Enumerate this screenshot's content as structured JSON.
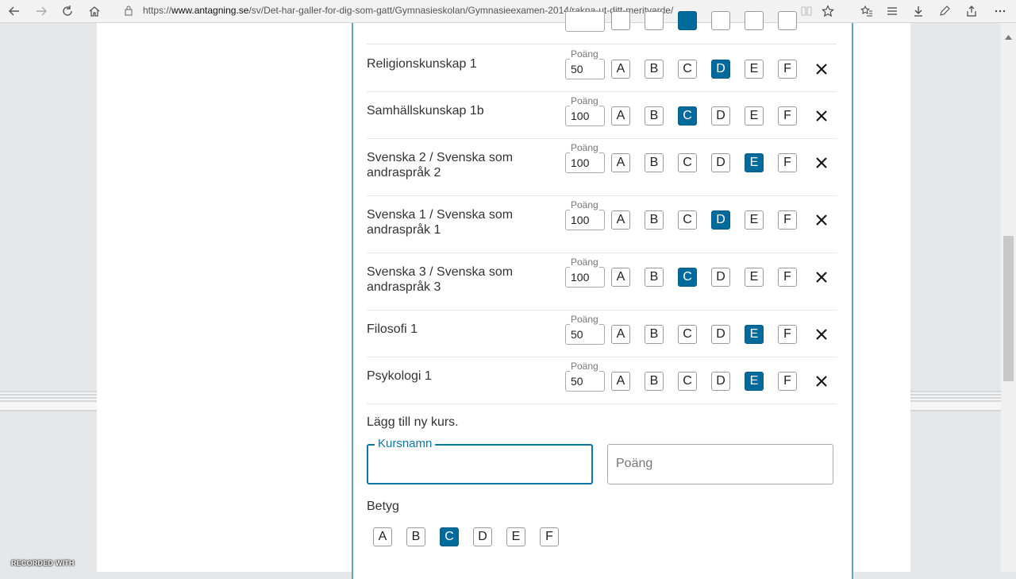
{
  "browser": {
    "url_prefix": "https://",
    "url_domain": "www.antagning.se",
    "url_path": "/sv/Det-har-galler-for-dig-som-gatt/Gymnasieskolan/Gymnasieexamen-2014/rakna-ut-ditt-meritvarde/"
  },
  "points_label": "Poäng",
  "courses": [
    {
      "name": "Religionskunskap 1",
      "points": "50",
      "grades": [
        "A",
        "B",
        "C",
        "D",
        "E",
        "F"
      ],
      "selected": "D"
    },
    {
      "name": "Samhällskunskap 1b",
      "points": "100",
      "grades": [
        "A",
        "B",
        "C",
        "D",
        "E",
        "F"
      ],
      "selected": "C"
    },
    {
      "name": "Svenska 2 / Svenska som andraspråk 2",
      "points": "100",
      "grades": [
        "A",
        "B",
        "C",
        "D",
        "E",
        "F"
      ],
      "selected": "E"
    },
    {
      "name": "Svenska 1 / Svenska som andraspråk 1",
      "points": "100",
      "grades": [
        "A",
        "B",
        "C",
        "D",
        "E",
        "F"
      ],
      "selected": "D"
    },
    {
      "name": "Svenska 3 / Svenska som andraspråk 3",
      "points": "100",
      "grades": [
        "A",
        "B",
        "C",
        "D",
        "E",
        "F"
      ],
      "selected": "C"
    },
    {
      "name": "Filosofi 1",
      "points": "50",
      "grades": [
        "A",
        "B",
        "C",
        "D",
        "E",
        "F"
      ],
      "selected": "E"
    },
    {
      "name": "Psykologi 1",
      "points": "50",
      "grades": [
        "A",
        "B",
        "C",
        "D",
        "E",
        "F"
      ],
      "selected": "E"
    }
  ],
  "new_course": {
    "title": "Lägg till ny kurs.",
    "name_label": "Kursnamn",
    "name_value": "",
    "points_placeholder": "Poäng",
    "grade_label": "Betyg",
    "grades": [
      "A",
      "B",
      "C",
      "D",
      "E",
      "F"
    ],
    "selected": "C"
  },
  "watermark": "RECORDED WITH",
  "colors": {
    "selected": "#006a9c",
    "focus": "#0a77a6",
    "panel_border": "#5aa5c6"
  }
}
